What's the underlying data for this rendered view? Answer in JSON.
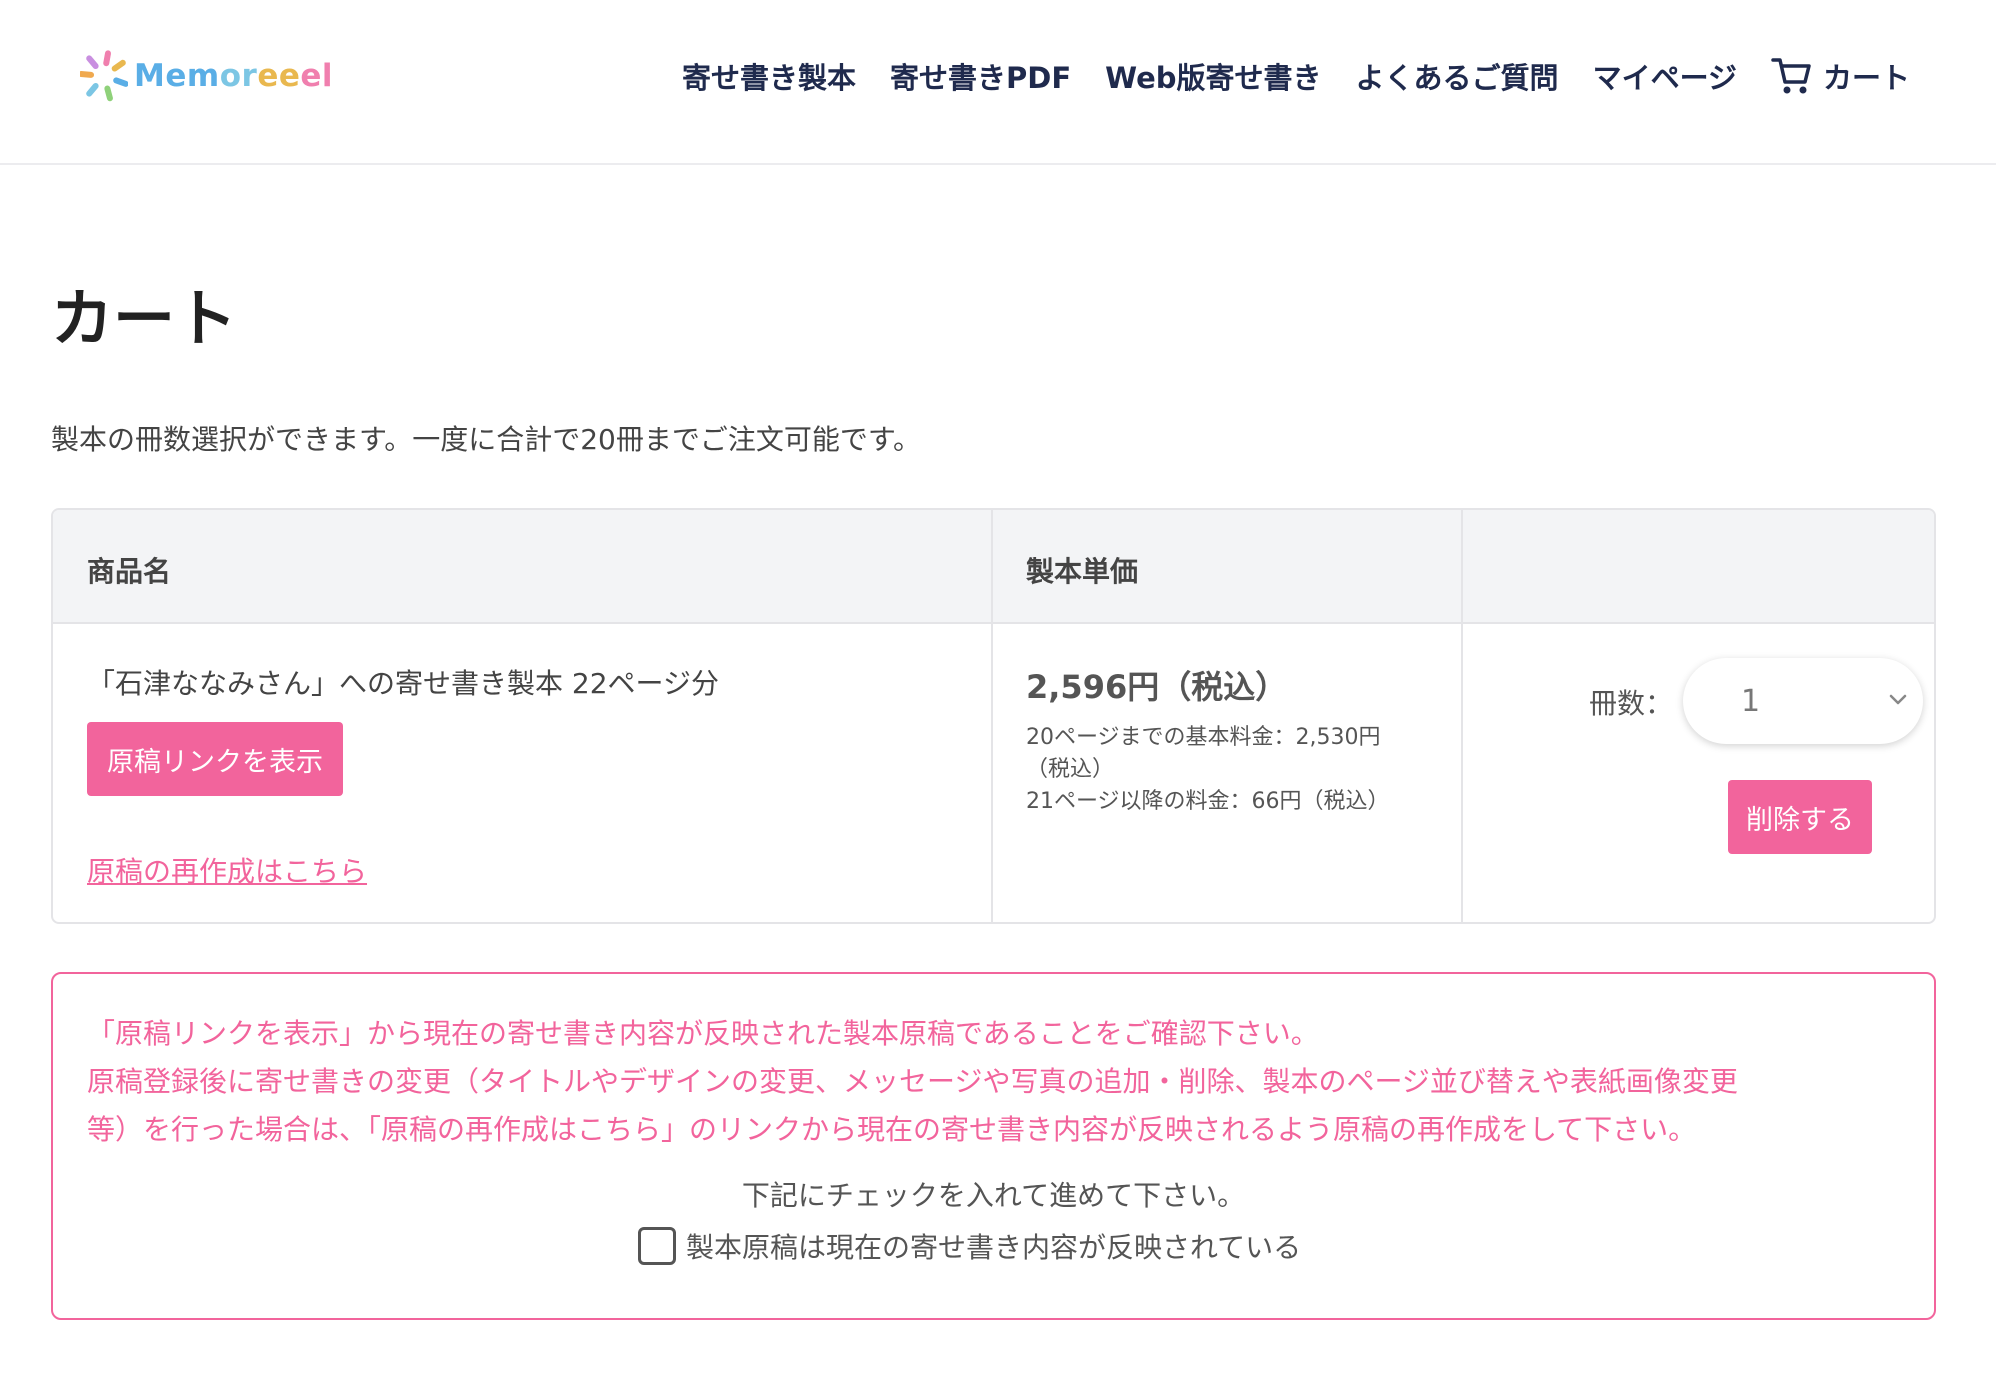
{
  "header": {
    "logo_text": "Memoreeel",
    "nav": [
      {
        "label": "寄せ書き製本"
      },
      {
        "label": "寄せ書きPDF"
      },
      {
        "label": "Web版寄せ書き"
      },
      {
        "label": "よくあるご質問"
      },
      {
        "label": "マイページ"
      },
      {
        "label": "カート",
        "icon": "cart-icon"
      }
    ]
  },
  "page": {
    "title": "カート",
    "intro": "製本の冊数選択ができます。一度に合計で20冊までご注文可能です。"
  },
  "table": {
    "headers": [
      "商品名",
      "製本単価",
      ""
    ],
    "row": {
      "product_name": "「石津ななみさん」への寄せ書き製本 22ページ分",
      "manuscript_button": "原稿リンクを表示",
      "recreate_link": "原稿の再作成はこちら",
      "price": "2,596円（税込）",
      "price_note_1": "20ページまでの基本料金：2,530円",
      "price_note_2": "（税込）",
      "price_note_3": "21ページ以降の料金：66円（税込）",
      "quantity_label": "冊数：",
      "quantity_value": "1",
      "delete_button": "削除する"
    }
  },
  "notice": {
    "line1": "「原稿リンクを表示」から現在の寄せ書き内容が反映された製本原稿であることをご確認下さい。",
    "line2": "原稿登録後に寄せ書きの変更（タイトルやデザインの変更、メッセージや写真の追加・削除、製本のページ並び替えや表紙画像変更",
    "line3": "等）を行った場合は、「原稿の再作成はこちら」のリンクから現在の寄せ書き内容が反映されるよう原稿の再作成をして下さい。",
    "check_instruction": "下記にチェックを入れて進めて下さい。",
    "checkbox_label": "製本原稿は現在の寄せ書き内容が反映されている"
  },
  "colors": {
    "accent": "#f2649c",
    "nav_text": "#1f2a4d",
    "table_header_bg": "#f3f4f6"
  }
}
